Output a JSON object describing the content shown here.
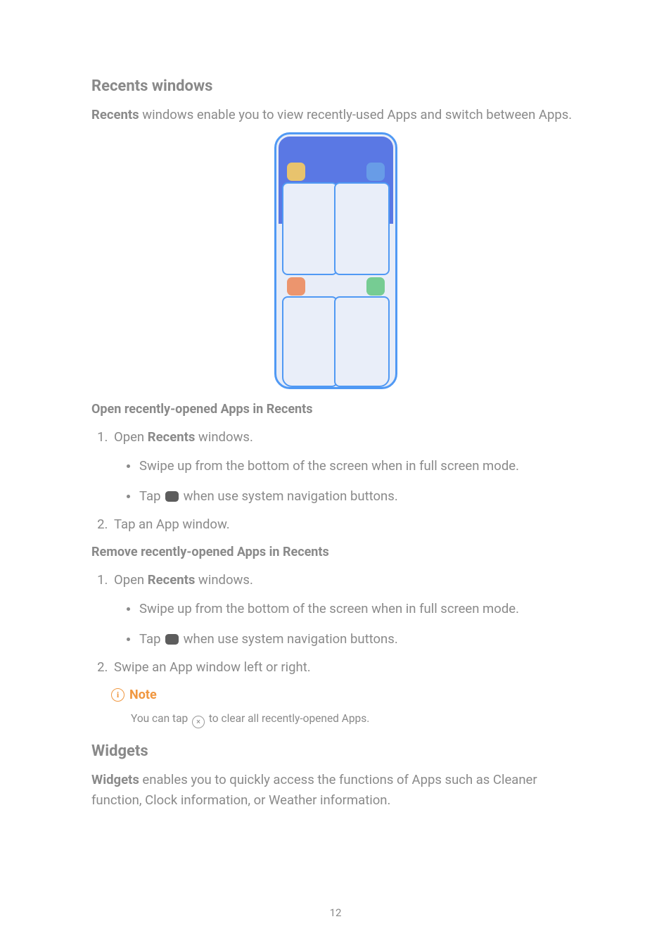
{
  "section1": {
    "title": "Recents windows",
    "intro_strong": "Recents",
    "intro_rest": " windows enable you to view recently-used Apps and switch between Apps.",
    "sub1_title": "Open recently-opened Apps in Recents",
    "step1_pre": "Open ",
    "step1_strong": "Recents",
    "step1_post": " windows.",
    "step1_bullets": {
      "a": "Swipe up from the bottom of the screen when in full screen mode.",
      "b_pre": "Tap ",
      "b_post": " when use system navigation buttons."
    },
    "step2": "Tap an App window.",
    "sub2_title": "Remove recently-opened Apps in Recents",
    "step2_1_pre": "Open ",
    "step2_1_strong": "Recents",
    "step2_1_post": " windows.",
    "step2_1_bullets": {
      "a": "Swipe up from the bottom of the screen when in full screen mode.",
      "b_pre": "Tap ",
      "b_post": " when use system navigation buttons."
    },
    "step2_2": "Swipe an App window left or right."
  },
  "note": {
    "label": "Note",
    "body_pre": "You can tap ",
    "body_post": " to clear all recently-opened Apps."
  },
  "section2": {
    "title": "Widgets",
    "intro_strong": "Widgets",
    "intro_rest": " enables you to quickly access the functions of Apps such as Cleaner function, Clock information, or Weather information."
  },
  "page_number": "12"
}
